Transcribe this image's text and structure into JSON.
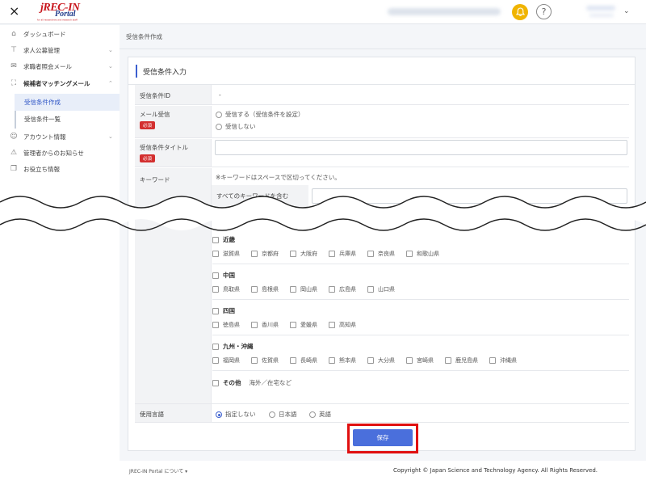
{
  "header": {
    "close_icon": "×",
    "logo_main": "jREC-IN",
    "logo_sub": "Portal",
    "logo_tagline": "for all researchers and research staff",
    "help_icon": "?",
    "user_chevron": "⌄",
    "bell_color": "#f0b400"
  },
  "sidebar": {
    "items": [
      {
        "icon": "home-icon",
        "glyph": "⌂",
        "label": "ダッシュボード"
      },
      {
        "icon": "sign-icon",
        "glyph": "⊤",
        "label": "求人公募管理",
        "chevron": "⌄"
      },
      {
        "icon": "mail-icon",
        "glyph": "✉",
        "label": "求職者照会メール",
        "chevron": "⌄"
      },
      {
        "icon": "person-icon",
        "glyph": "⛶",
        "label": "候補者マッチングメール",
        "chevron": "⌃"
      },
      {
        "icon": "account-icon",
        "glyph": "☺",
        "label": "アカウント情報",
        "chevron": "⌄"
      },
      {
        "icon": "warning-icon",
        "glyph": "⚠",
        "label": "管理者からのお知らせ"
      },
      {
        "icon": "book-icon",
        "glyph": "❐",
        "label": "お役立ち情報"
      }
    ],
    "subitems": [
      {
        "label": "受信条件作成",
        "active": true
      },
      {
        "label": "受信条件一覧",
        "active": false
      }
    ]
  },
  "breadcrumb": "受信条件作成",
  "form": {
    "title": "受信条件入力",
    "required_badge": "必須",
    "id": {
      "label": "受信条件ID",
      "value": "-"
    },
    "mail": {
      "label": "メール受信",
      "options": [
        "受信する（受信条件を設定）",
        "受信しない"
      ]
    },
    "title_field": {
      "label": "受信条件タイトル",
      "value": ""
    },
    "keyword": {
      "label": "キーワード",
      "note": "※キーワードはスペースで区切ってください。",
      "all_label": "すべてのキーワードを含む"
    },
    "regions": [
      {
        "name": "近畿",
        "prefs": [
          "滋賀県",
          "京都府",
          "大阪府",
          "兵庫県",
          "奈良県",
          "和歌山県"
        ]
      },
      {
        "name": "中国",
        "prefs": [
          "鳥取県",
          "島根県",
          "岡山県",
          "広島県",
          "山口県"
        ]
      },
      {
        "name": "四国",
        "prefs": [
          "徳島県",
          "香川県",
          "愛媛県",
          "高知県"
        ]
      },
      {
        "name": "九州・沖縄",
        "prefs": [
          "福岡県",
          "佐賀県",
          "長崎県",
          "熊本県",
          "大分県",
          "宮崎県",
          "鹿児島県",
          "沖縄県"
        ]
      }
    ],
    "other": {
      "name": "その他",
      "note": "海外／在宅など"
    },
    "language": {
      "label": "使用言語",
      "options": [
        "指定しない",
        "日本語",
        "英語"
      ],
      "selected": "指定しない"
    },
    "save_label": "保存"
  },
  "footer": {
    "about": "JREC-IN Portal について ▾",
    "copyright": "Copyright © Japan Science and Technology Agency. All Rights Reserved."
  }
}
